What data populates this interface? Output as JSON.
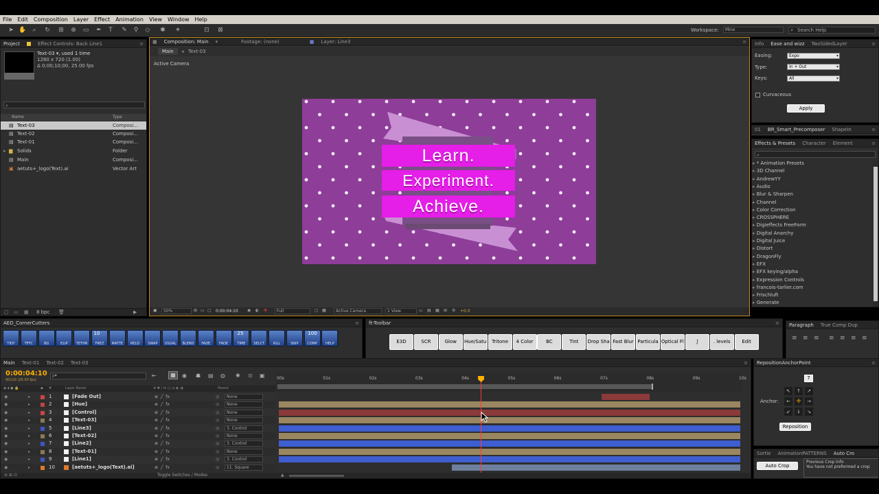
{
  "menu": [
    "File",
    "Edit",
    "Composition",
    "Layer",
    "Effect",
    "Animation",
    "View",
    "Window",
    "Help"
  ],
  "workspace": {
    "label": "Workspace:",
    "value": "Mine",
    "search_placeholder": "Search Help"
  },
  "project": {
    "tabs": [
      "Project",
      "Effect Controls: Back Line1"
    ],
    "item_name": "Text-03 ▾",
    "item_used": ", used 1 time",
    "item_size": "1280 x 720 (1.00)",
    "item_duration": "Δ 0;00;10;00, 25.00 fps",
    "columns": {
      "name": "Name",
      "type": "Type"
    },
    "items": [
      {
        "name": "Text-03",
        "type": "Composi..."
      },
      {
        "name": "Text-02",
        "type": "Composi..."
      },
      {
        "name": "Text-01",
        "type": "Composi..."
      },
      {
        "name": "Solids",
        "type": "Folder"
      },
      {
        "name": "Main",
        "type": "Composi..."
      },
      {
        "name": "aetuts+_logo(Text).ai",
        "type": "Vector Art"
      }
    ],
    "bpc": "8 bpc"
  },
  "viewer": {
    "tabs": [
      "Composition: Main",
      "Footage: (none)",
      "Layer: Line3"
    ],
    "subtabs": [
      "Main",
      "Text-03"
    ],
    "camera_label": "Active Camera",
    "ribbon": [
      "Learn.",
      "Experiment.",
      "Achieve."
    ],
    "bottom": {
      "zoom": "50%",
      "timecode": "0:00:04:10",
      "resolution": "Full",
      "camera": "Active Camera",
      "views": "1 View",
      "exposure": "+0.0"
    }
  },
  "ease": {
    "tabs": [
      "Info",
      "Ease and wizz",
      "TwoSidedLayer"
    ],
    "easing_label": "Easing:",
    "easing": "Expo",
    "type_label": "Type:",
    "type": "In + Out",
    "keys_label": "Keys:",
    "keys": "All",
    "curvaceous": "Curvaceous",
    "apply": "Apply"
  },
  "precomposer": {
    "tabs": [
      "01",
      "BR_Smart_Precomposer",
      "ShapeIn"
    ]
  },
  "effects": {
    "tabs": [
      "Effects & Presets",
      "Character",
      "Element"
    ],
    "items": [
      "* Animation Presets",
      "3D Channel",
      "AndrewYY",
      "Audio",
      "Blur & Sharpen",
      "Channel",
      "Color Correction",
      "CROSSPHERE",
      "Digieffects FreeForm",
      "Digital Anarchy",
      "Digital Juice",
      "Distort",
      "DragonFly",
      "EFX",
      "EFX keying/alpha",
      "Expression Controls",
      "francois-tarlier.com",
      "Frischluft",
      "Generate"
    ]
  },
  "aed": {
    "title": "AED_CornerCutters",
    "buttons": [
      "TIDY",
      "TFFC",
      "BG",
      "ELIP",
      "TETHR",
      "FREZ",
      "MATTE",
      "RELD",
      "SWAP",
      "USUAL",
      "BLEND",
      "FADE",
      "FADE",
      "TIME",
      "SELCT",
      "KILL",
      "SNIP",
      "COMP",
      "HELP"
    ],
    "field_value": "10",
    "field2": "25",
    "field3": "100"
  },
  "fttoolbar": {
    "title": "ft-Toolbar",
    "buttons": [
      "E3D",
      "SCR",
      "Glow",
      "Hue/Satu",
      "Tritone",
      "4 Color",
      "BC",
      "Tint",
      "Drop Sha",
      "Fast Blur",
      "Particula",
      "Optical Fl",
      "∫",
      ". levels",
      "Edit"
    ]
  },
  "paragraph": {
    "tabs": [
      "Paragraph",
      "True Comp Dup"
    ]
  },
  "timeline": {
    "tabs": [
      "Main",
      "Text-01",
      "Text-02",
      "Text-03"
    ],
    "timecode": "0:00:04:10",
    "fps": "00110 (25.00 fps)",
    "search_placeholder": "ρ▾",
    "col_layer": "Layer Name",
    "col_parent": "Parent",
    "ruler": [
      "00s",
      "01s",
      "02s",
      "03s",
      "04s",
      "05s",
      "06s",
      "07s",
      "08s",
      "09s",
      "10s"
    ],
    "layers": [
      {
        "num": "1",
        "name": "[Fade Out]",
        "parent": "None"
      },
      {
        "num": "2",
        "name": "[Hue]",
        "parent": "None"
      },
      {
        "num": "3",
        "name": "[Control]",
        "parent": "None"
      },
      {
        "num": "4",
        "name": "[Text-03]",
        "parent": "None"
      },
      {
        "num": "5",
        "name": "[Line3]",
        "parent": "3. Control"
      },
      {
        "num": "6",
        "name": "[Text-02]",
        "parent": "None"
      },
      {
        "num": "7",
        "name": "[Line2]",
        "parent": "3. Control"
      },
      {
        "num": "8",
        "name": "[Text-01]",
        "parent": "None"
      },
      {
        "num": "9",
        "name": "[Line1]",
        "parent": "3. Control"
      },
      {
        "num": "10",
        "name": "[aetuts+_logo(Text).ai]",
        "parent": "11. Square"
      }
    ],
    "toggle": "Toggle Switches / Modes"
  },
  "reposition": {
    "title": "RepositionAnchorPoint",
    "field": "7",
    "anchor_label": "Anchor:",
    "button": "Reposition"
  },
  "autocrop": {
    "tabs": [
      "Sortie",
      "AnimationPATTERNS",
      "Auto Cro"
    ],
    "button": "Auto Crop",
    "info_title": "Previous Crop Info",
    "info_text": "You have not preformed a crop"
  },
  "colors": {
    "accent": "#ffb000",
    "magenta": "#e51ee8",
    "purple": "#8e3d99",
    "playhead": "#ff3a3a",
    "layer_blue": "#3f5ed0",
    "layer_tan": "#9a8660",
    "layer_red": "#8b3a3a"
  }
}
